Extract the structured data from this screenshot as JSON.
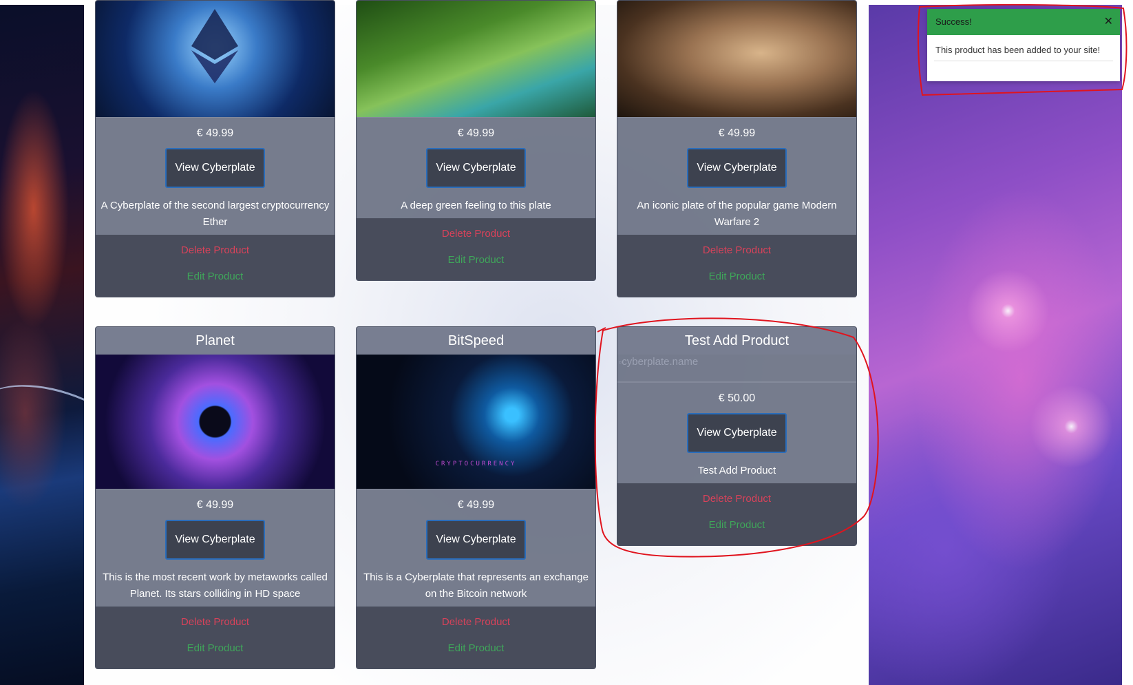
{
  "toast": {
    "title": "Success!",
    "message": "This product has been added to your site!",
    "close_glyph": "✕"
  },
  "products": [
    {
      "title": "",
      "price": "€ 49.99",
      "view_label": "View Cyberplate",
      "description": "A Cyberplate of the second largest cryptocurrency Ether",
      "delete_label": "Delete Product",
      "edit_label": "Edit Product"
    },
    {
      "title": "",
      "price": "€ 49.99",
      "view_label": "View Cyberplate",
      "description": "A deep green feeling to this plate",
      "delete_label": "Delete Product",
      "edit_label": "Edit Product"
    },
    {
      "title": "",
      "price": "€ 49.99",
      "view_label": "View Cyberplate",
      "description": "An iconic plate of the popular game Modern Warfare 2",
      "delete_label": "Delete Product",
      "edit_label": "Edit Product"
    },
    {
      "title": "Planet",
      "price": "€ 49.99",
      "view_label": "View Cyberplate",
      "description": "This is the most recent work by metaworks called Planet. Its stars colliding in HD space",
      "delete_label": "Delete Product",
      "edit_label": "Edit Product"
    },
    {
      "title": "BitSpeed",
      "price": "€ 49.99",
      "view_label": "View Cyberplate",
      "description": "This is a Cyberplate that represents an exchange on the Bitcoin network",
      "delete_label": "Delete Product",
      "edit_label": "Edit Product",
      "image_text": "CRYPTOCURRENCY"
    },
    {
      "title": "Test Add Product",
      "price": "€ 50.00",
      "view_label": "View Cyberplate",
      "description": "Test Add Product",
      "delete_label": "Delete Product",
      "edit_label": "Edit Product",
      "image_alt": "cyberplate.name"
    }
  ],
  "colors": {
    "success": "#2e9e4a",
    "delete": "#d9425a",
    "edit": "#3fa65a",
    "annotation": "#e0141e"
  }
}
